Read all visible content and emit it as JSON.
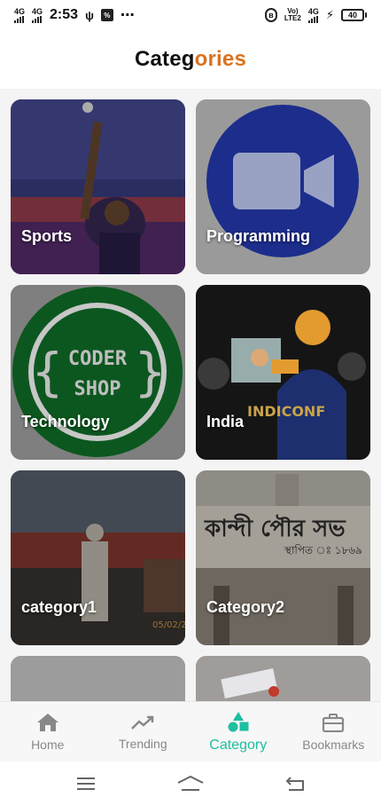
{
  "status_bar": {
    "signal1": "4G",
    "signal2": "4G",
    "time": "2:53",
    "extra": "⋯",
    "volte_top": "Vo)",
    "volte_bottom": "LTE2",
    "network": "4G",
    "battery": "40"
  },
  "header": {
    "title_part1": "Categ",
    "title_part2": "ories"
  },
  "categories": [
    {
      "label": "Sports"
    },
    {
      "label": "Programming"
    },
    {
      "label": "Technology"
    },
    {
      "label": "India"
    },
    {
      "label": "category1"
    },
    {
      "label": "Category2"
    },
    {
      "label": ""
    },
    {
      "label": ""
    }
  ],
  "tile_text": {
    "coder_line1": "CODER",
    "coder_line2": "SHOP",
    "indiconf": "INDICONF",
    "photo_date": "05/02/2",
    "sign_text": "কান্দী পৌর সভ",
    "sign_sub": "স্থাপিত ঃ ১৮৬৯"
  },
  "bottom_nav": [
    {
      "label": "Home",
      "icon": "home-icon",
      "active": false
    },
    {
      "label": "Trending",
      "icon": "trending-icon",
      "active": false
    },
    {
      "label": "Category",
      "icon": "category-icon",
      "active": true
    },
    {
      "label": "Bookmarks",
      "icon": "briefcase-icon",
      "active": false
    }
  ],
  "colors": {
    "accent": "#1dbf9f",
    "title_highlight": "#d9731f",
    "inactive": "#888888"
  }
}
